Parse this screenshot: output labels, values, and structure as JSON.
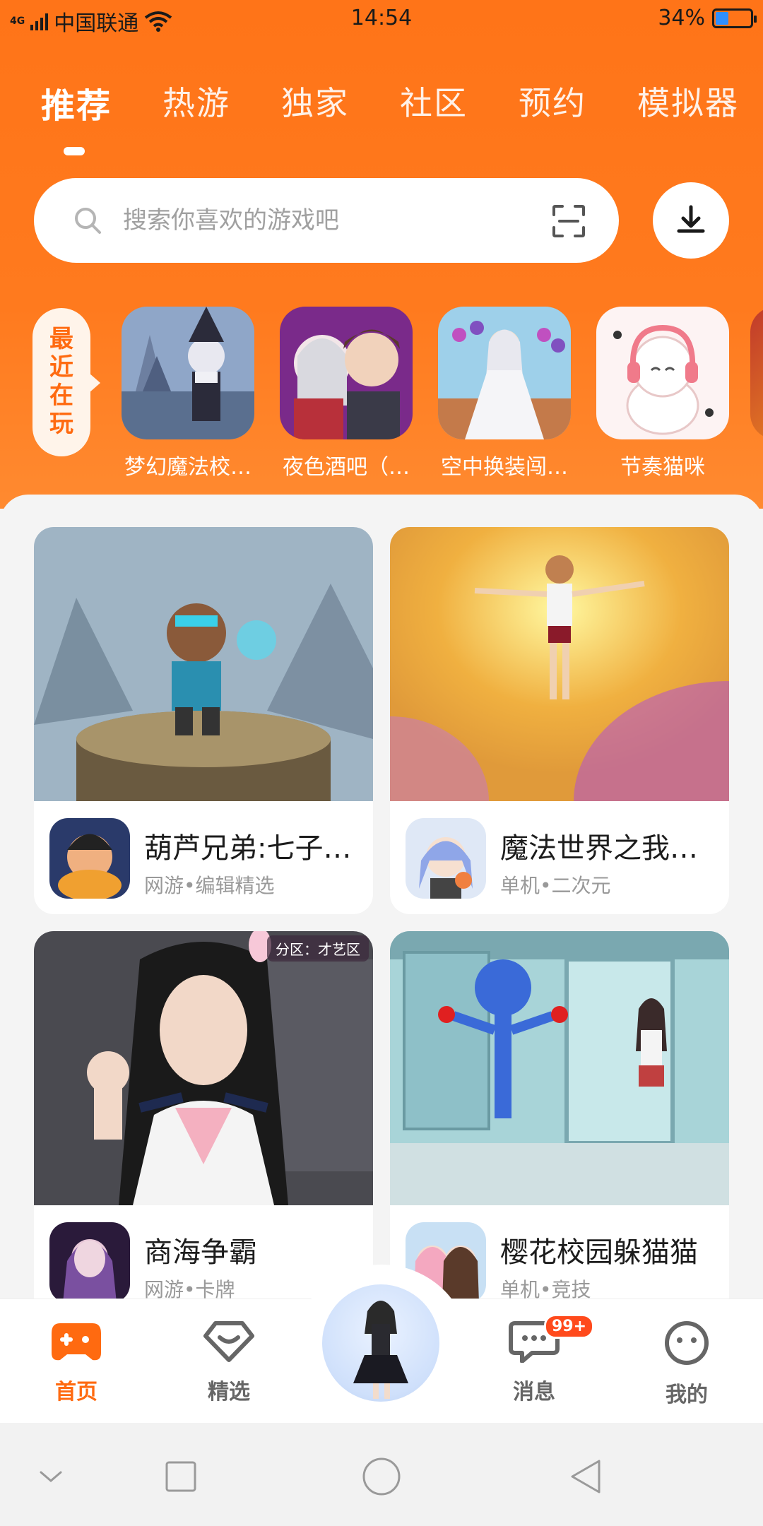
{
  "status_bar": {
    "network": "4G",
    "carrier": "中国联通",
    "time": "14:54",
    "battery": "34%",
    "battery_level": 0.34
  },
  "tabs": [
    "推荐",
    "热游",
    "独家",
    "社区",
    "预约",
    "模拟器"
  ],
  "active_tab": 0,
  "search": {
    "placeholder": "搜索你喜欢的游戏吧"
  },
  "recent": {
    "label": "最近在玩",
    "items": [
      {
        "name": "梦幻魔法校…"
      },
      {
        "name": "夜色酒吧（…"
      },
      {
        "name": "空中换装闯…"
      },
      {
        "name": "节奏猫咪"
      }
    ]
  },
  "cards": [
    {
      "name": "葫芦兄弟:七子…",
      "meta": "网游•编辑精选"
    },
    {
      "name": "魔法世界之我…",
      "meta": "单机•二次元"
    },
    {
      "name": "商海争霸",
      "meta": "网游•卡牌",
      "badge": "分区：才艺区"
    },
    {
      "name": "樱花校园躲猫猫",
      "meta": "单机•竞技"
    }
  ],
  "bottom_nav": {
    "home": "首页",
    "featured": "精选",
    "messages": "消息",
    "messages_badge": "99+",
    "mine": "我的"
  },
  "colors": {
    "brand": "#ff7418",
    "accent_text": "#ff6a10"
  }
}
